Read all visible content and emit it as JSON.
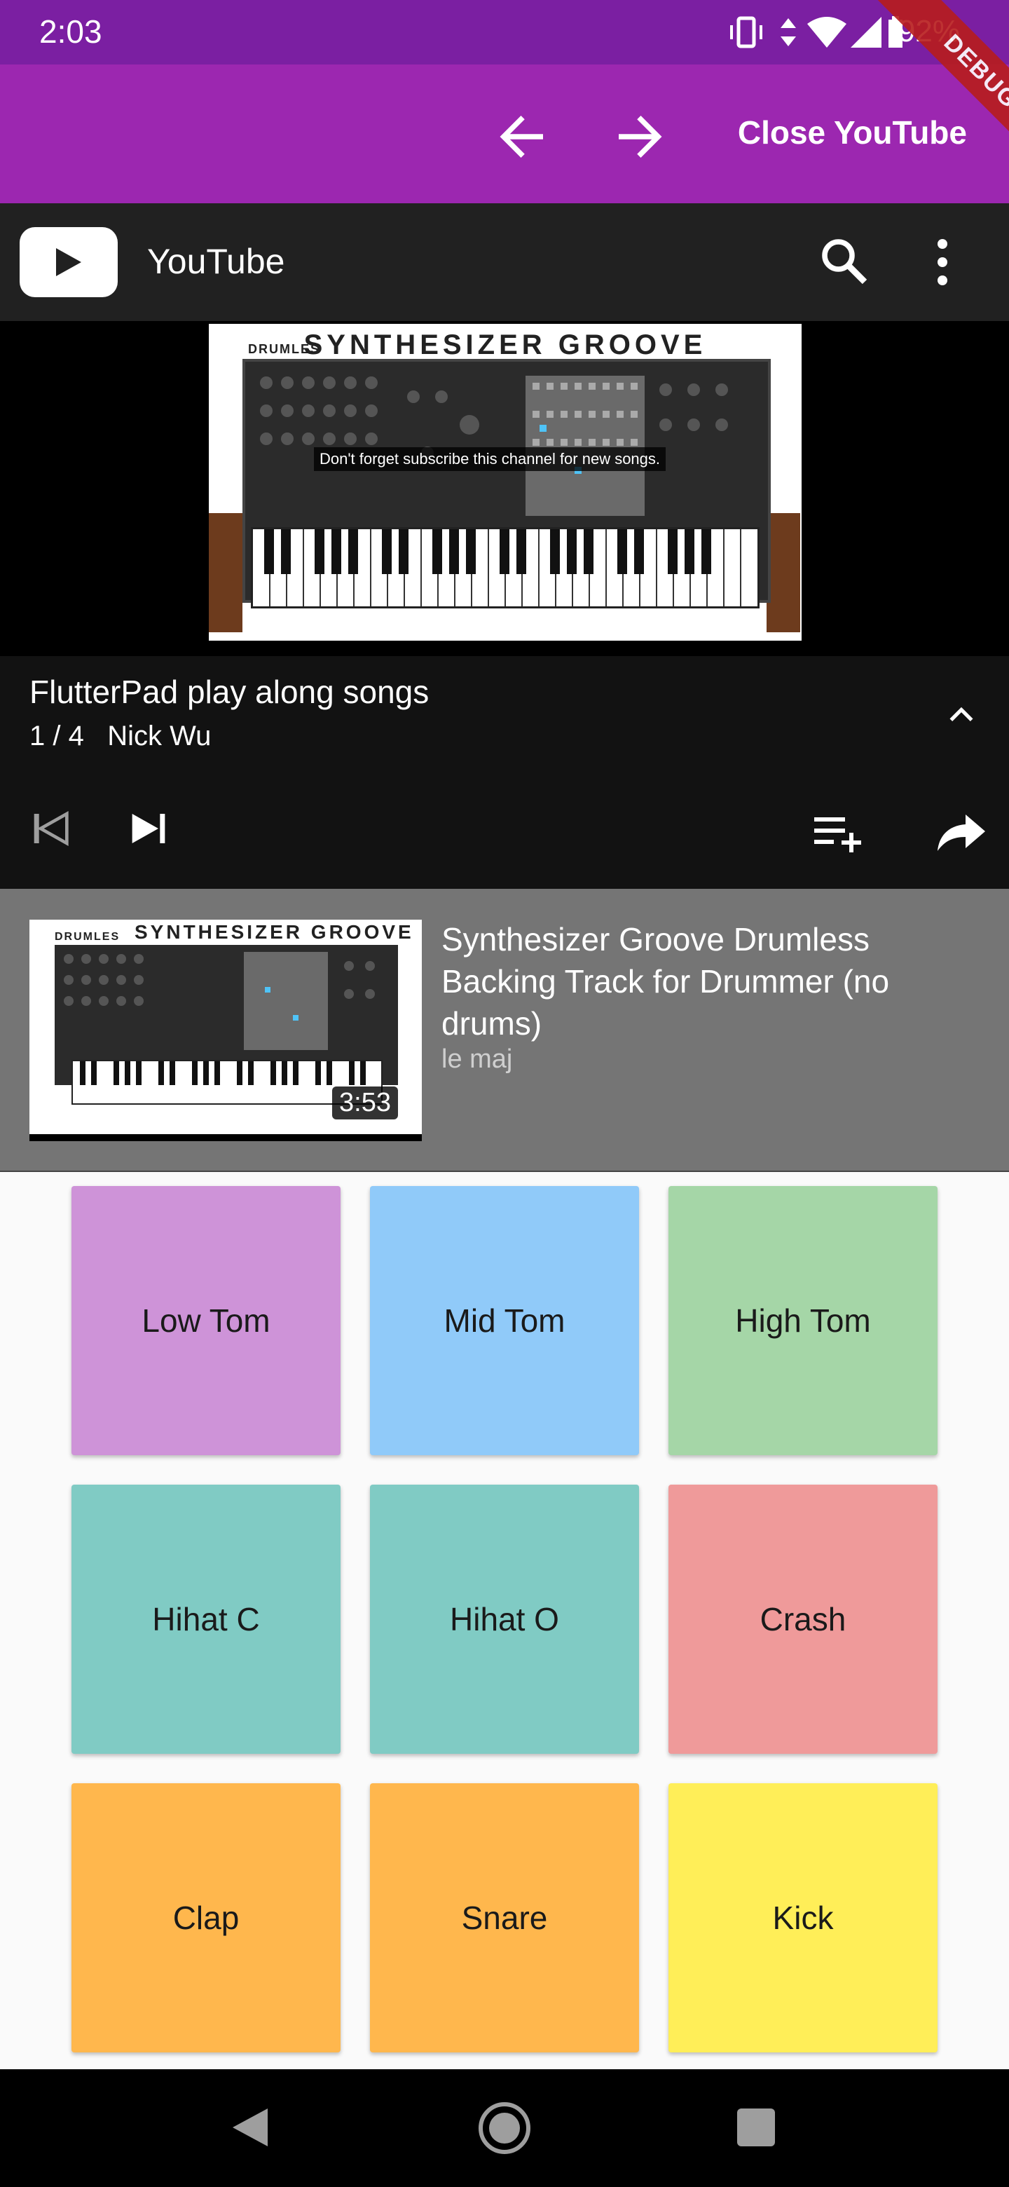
{
  "status_bar": {
    "time": "2:03",
    "battery": "92%",
    "icons": [
      "vibrate-icon",
      "data-arrows-icon",
      "wifi-icon",
      "signal-icon",
      "battery-icon"
    ]
  },
  "debug_banner": "DEBUG",
  "app_bar": {
    "back_icon": "arrow-back-icon",
    "forward_icon": "arrow-forward-icon",
    "close_label": "Close YouTube"
  },
  "youtube_header": {
    "title": "YouTube",
    "icons": [
      "youtube-logo-icon",
      "search-icon",
      "more-vert-icon"
    ]
  },
  "video": {
    "brand": "DRUMLES",
    "heading": "SYNTHESIZER GROOVE",
    "caption": "Don't forget subscribe this channel for new songs."
  },
  "player": {
    "playlist_title": "FlutterPad play along songs",
    "position": "1 / 4",
    "author": "Nick Wu",
    "icons": [
      "expand-less-icon",
      "skip-previous-icon",
      "skip-next-icon",
      "playlist-add-icon",
      "share-icon"
    ]
  },
  "playlist_item": {
    "thumb_heading": "SYNTHESIZER GROOVE",
    "thumb_brand": "DRUMLES",
    "duration": "3:53",
    "title": "Synthesizer Groove Drumless Backing Track for Drummer (no drums)",
    "channel": "le maj"
  },
  "pads": [
    {
      "label": "Low Tom",
      "color": "#ce93d8"
    },
    {
      "label": "Mid Tom",
      "color": "#90caf9"
    },
    {
      "label": "High Tom",
      "color": "#a5d6a7"
    },
    {
      "label": "Hihat C",
      "color": "#80cbc4"
    },
    {
      "label": "Hihat O",
      "color": "#80cbc4"
    },
    {
      "label": "Crash",
      "color": "#ef9a9a"
    },
    {
      "label": "Clap",
      "color": "#ffb74d"
    },
    {
      "label": "Snare",
      "color": "#ffb74d"
    },
    {
      "label": "Kick",
      "color": "#ffee58"
    }
  ],
  "nav_bar": {
    "icons": [
      "nav-back-icon",
      "nav-home-icon",
      "nav-recents-icon"
    ]
  },
  "colors": {
    "status_bar": "#7b1fa2",
    "app_bar": "#9c27b0",
    "youtube_header": "#212121",
    "player_bg": "#121212",
    "playlist_item_bg": "#757575"
  }
}
